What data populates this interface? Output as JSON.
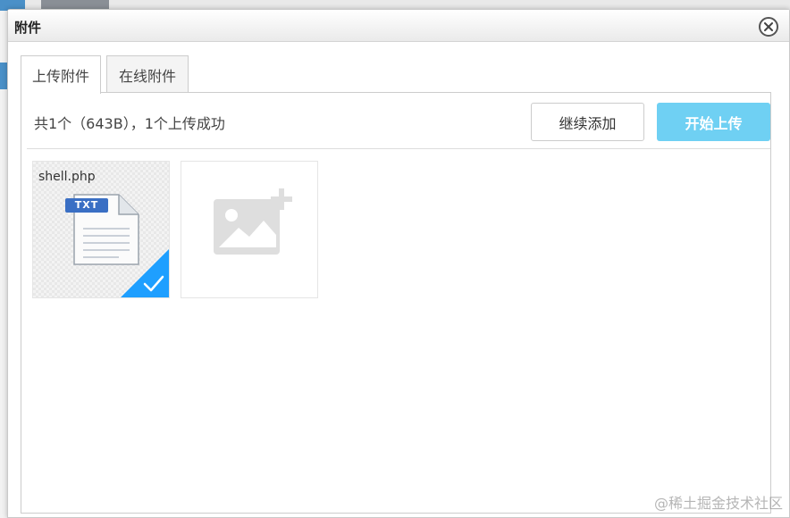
{
  "dialog": {
    "title": "附件",
    "close_icon": "close-icon"
  },
  "tabs": [
    {
      "label": "上传附件",
      "active": true
    },
    {
      "label": "在线附件",
      "active": false
    }
  ],
  "upload": {
    "status": "共1个（643B），1个上传成功",
    "continue_label": "继续添加",
    "start_label": "开始上传",
    "start_color": "#6fd0f3"
  },
  "files": [
    {
      "name": "shell.php",
      "type_badge": "TXT",
      "state": "success",
      "icon": "txt-file-icon"
    }
  ],
  "add_placeholder": {
    "icon": "add-image-icon"
  },
  "watermark": "@稀土掘金技术社区",
  "colors": {
    "success_corner": "#1e9fff",
    "badge": "#3a6fc4"
  }
}
